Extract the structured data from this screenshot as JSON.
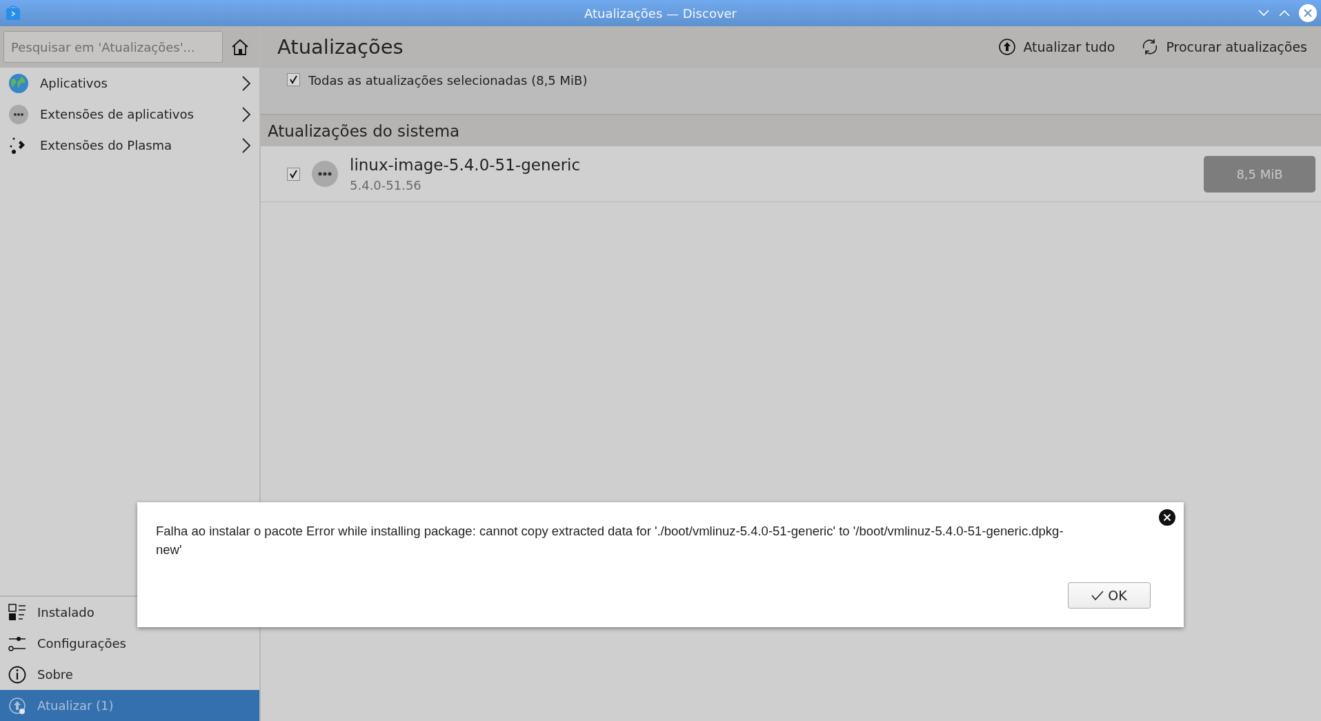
{
  "window": {
    "title": "Atualizações — Discover"
  },
  "sidebar": {
    "search": {
      "placeholder": "Pesquisar em 'Atualizações'..."
    },
    "categories": [
      {
        "label": "Aplicativos",
        "selected": false
      },
      {
        "label": "Extensões de aplicativos",
        "selected": false
      },
      {
        "label": "Extensões do Plasma",
        "selected": false
      }
    ],
    "bottom_items": [
      {
        "label": "Instalado",
        "selected": false
      },
      {
        "label": "Configurações",
        "selected": false
      },
      {
        "label": "Sobre",
        "selected": false
      },
      {
        "label": "Atualizar (1)",
        "selected": true
      }
    ]
  },
  "header": {
    "title": "Atualizações",
    "actions": [
      {
        "label": "Atualizar tudo"
      },
      {
        "label": "Procurar atualizações"
      }
    ]
  },
  "select_all": {
    "label": "Todas as atualizações selecionadas (8,5 MiB)",
    "checked": true
  },
  "sections": [
    {
      "title": "Atualizações do sistema",
      "items": [
        {
          "name": "linux-image-5.4.0-51-generic",
          "version": "5.4.0-51.56",
          "size": "8,5 MiB",
          "checked": true
        }
      ]
    }
  ],
  "dialog": {
    "message": "Falha ao instalar o pacote Error while installing package: cannot copy extracted data for './boot/vmlinuz-5.4.0-51-generic' to '/boot/vmlinuz-5.4.0-51-generic.dpkg-new'",
    "button": "OK"
  }
}
